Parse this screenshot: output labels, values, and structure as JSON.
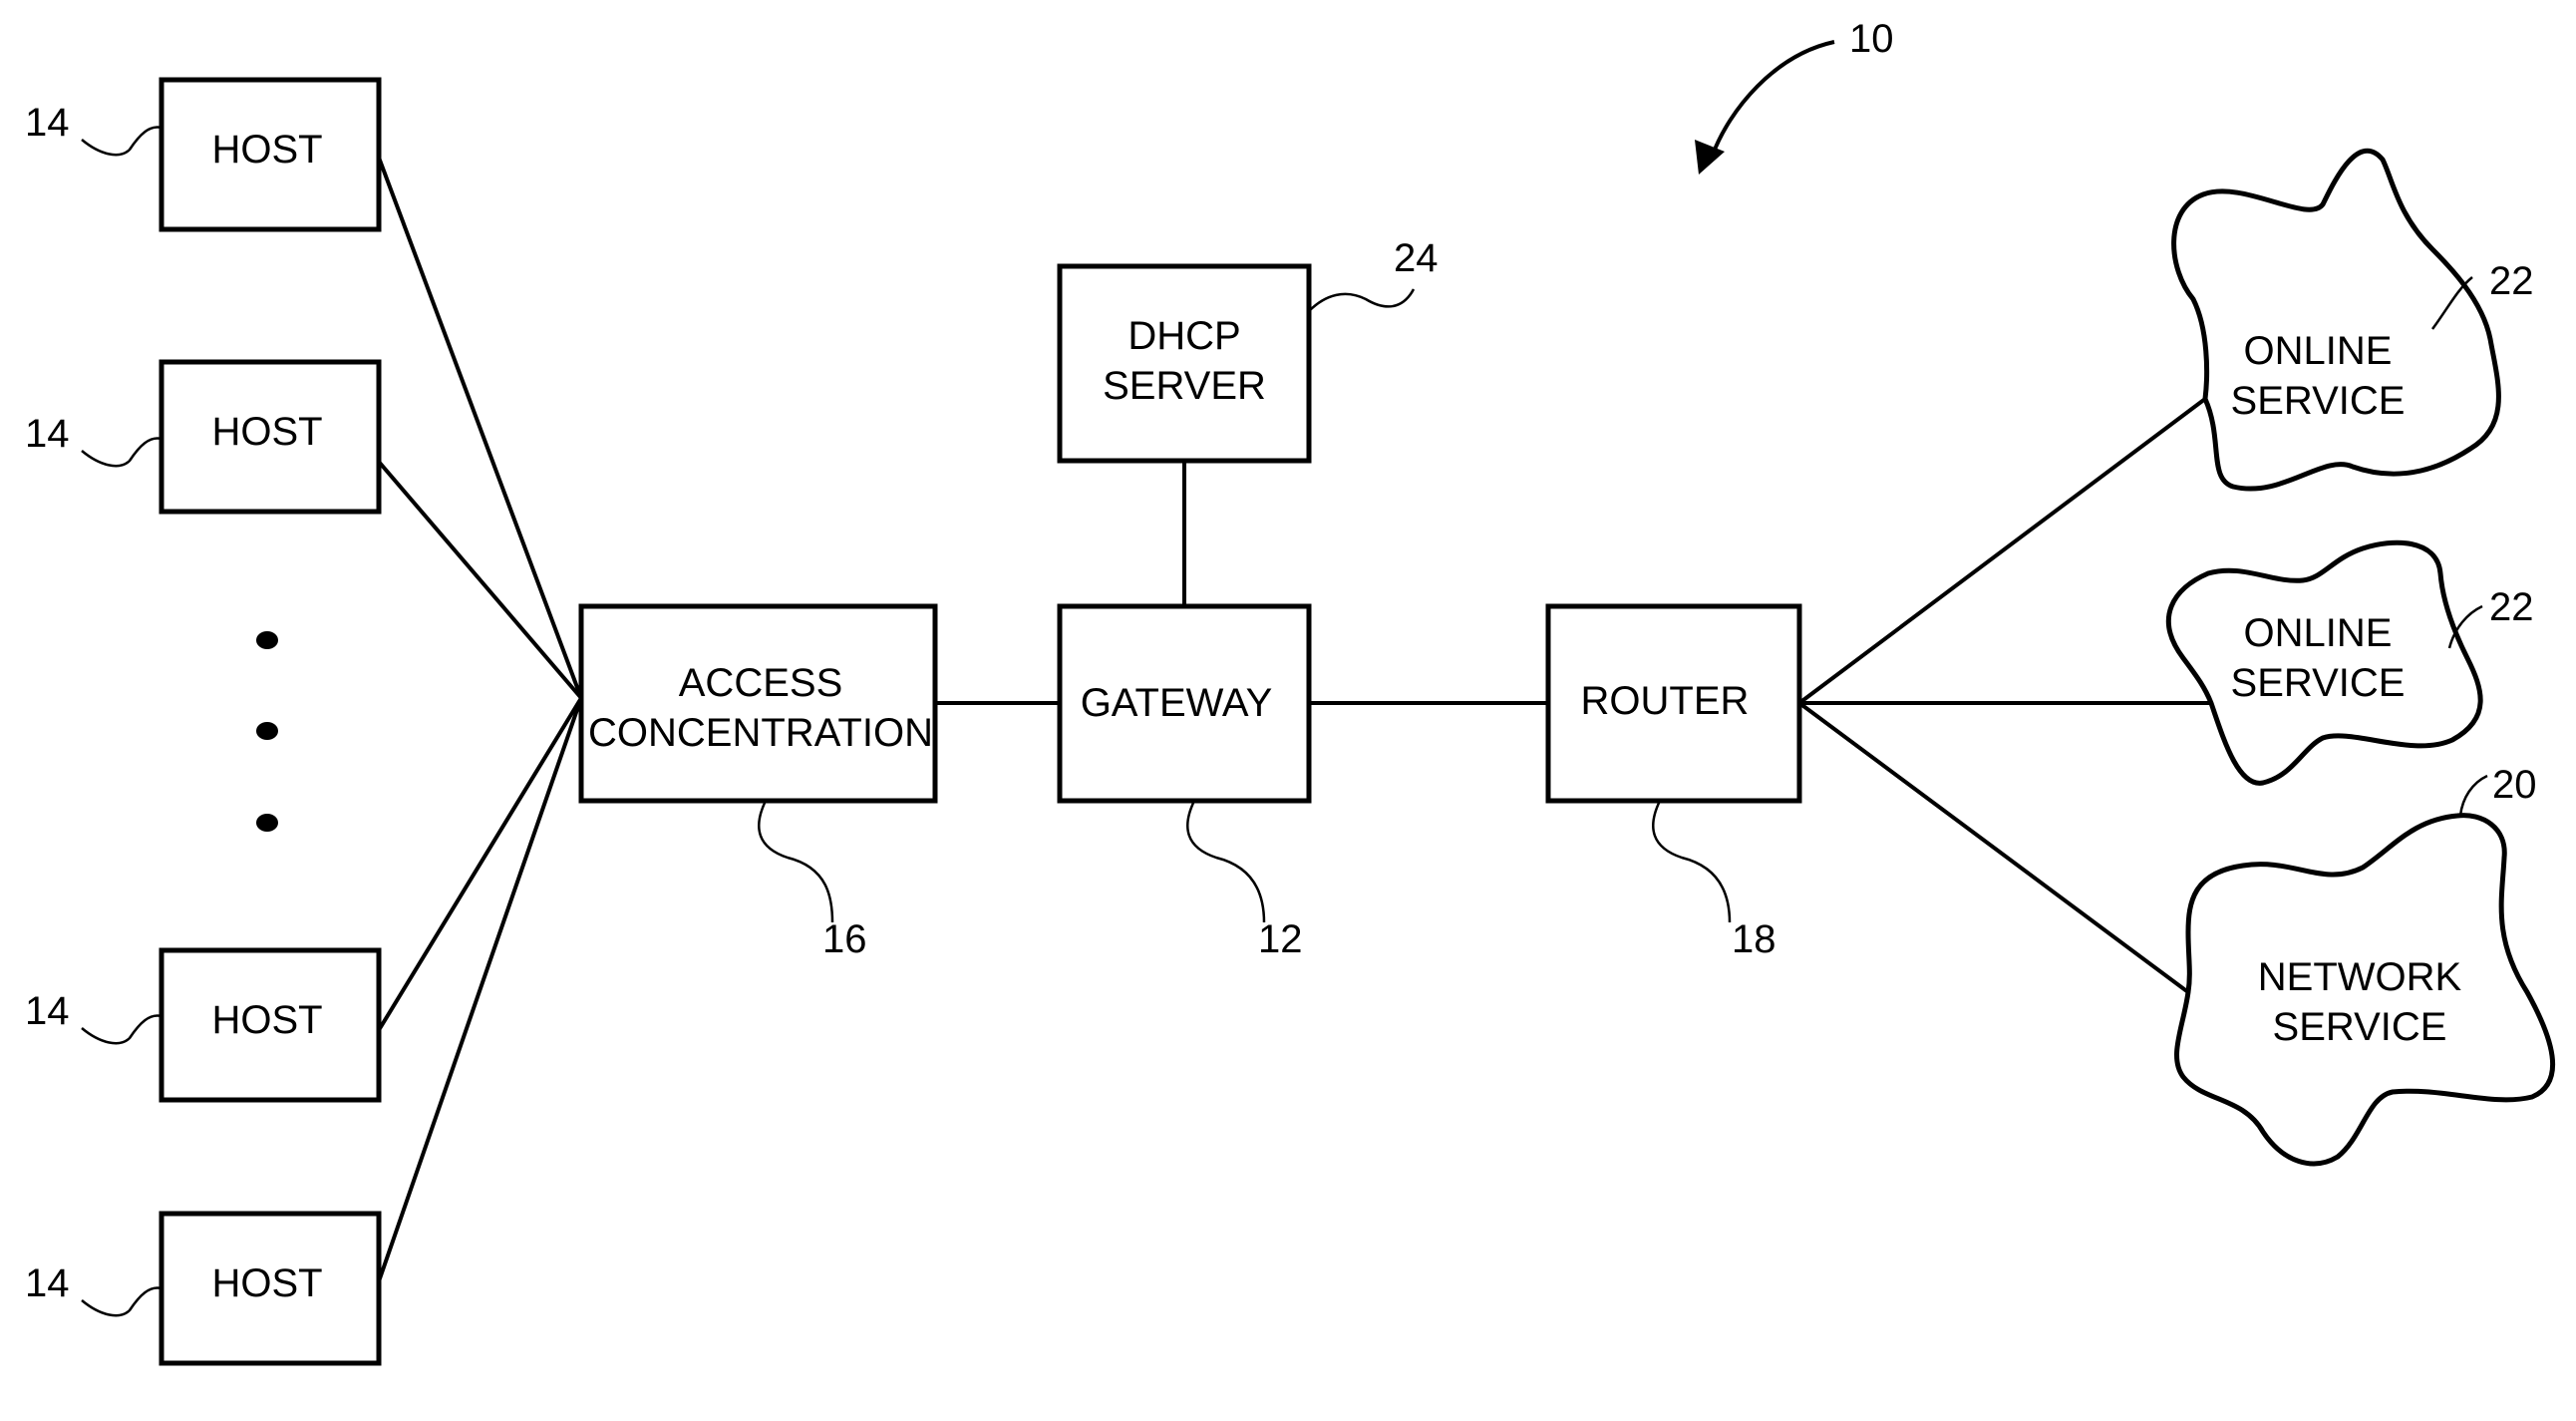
{
  "figure_ref": "10",
  "hosts": [
    {
      "label": "HOST",
      "ref": "14"
    },
    {
      "label": "HOST",
      "ref": "14"
    },
    {
      "label": "HOST",
      "ref": "14"
    },
    {
      "label": "HOST",
      "ref": "14"
    }
  ],
  "access": {
    "line1": "ACCESS",
    "line2": "CONCENTRATION",
    "ref": "16"
  },
  "gateway": {
    "label": "GATEWAY",
    "ref": "12"
  },
  "dhcp": {
    "line1": "DHCP",
    "line2": "SERVER",
    "ref": "24"
  },
  "router": {
    "label": "ROUTER",
    "ref": "18"
  },
  "online_service_1": {
    "line1": "ONLINE",
    "line2": "SERVICE",
    "ref": "22"
  },
  "online_service_2": {
    "line1": "ONLINE",
    "line2": "SERVICE",
    "ref": "22"
  },
  "network_service": {
    "line1": "NETWORK",
    "line2": "SERVICE",
    "ref": "20"
  }
}
